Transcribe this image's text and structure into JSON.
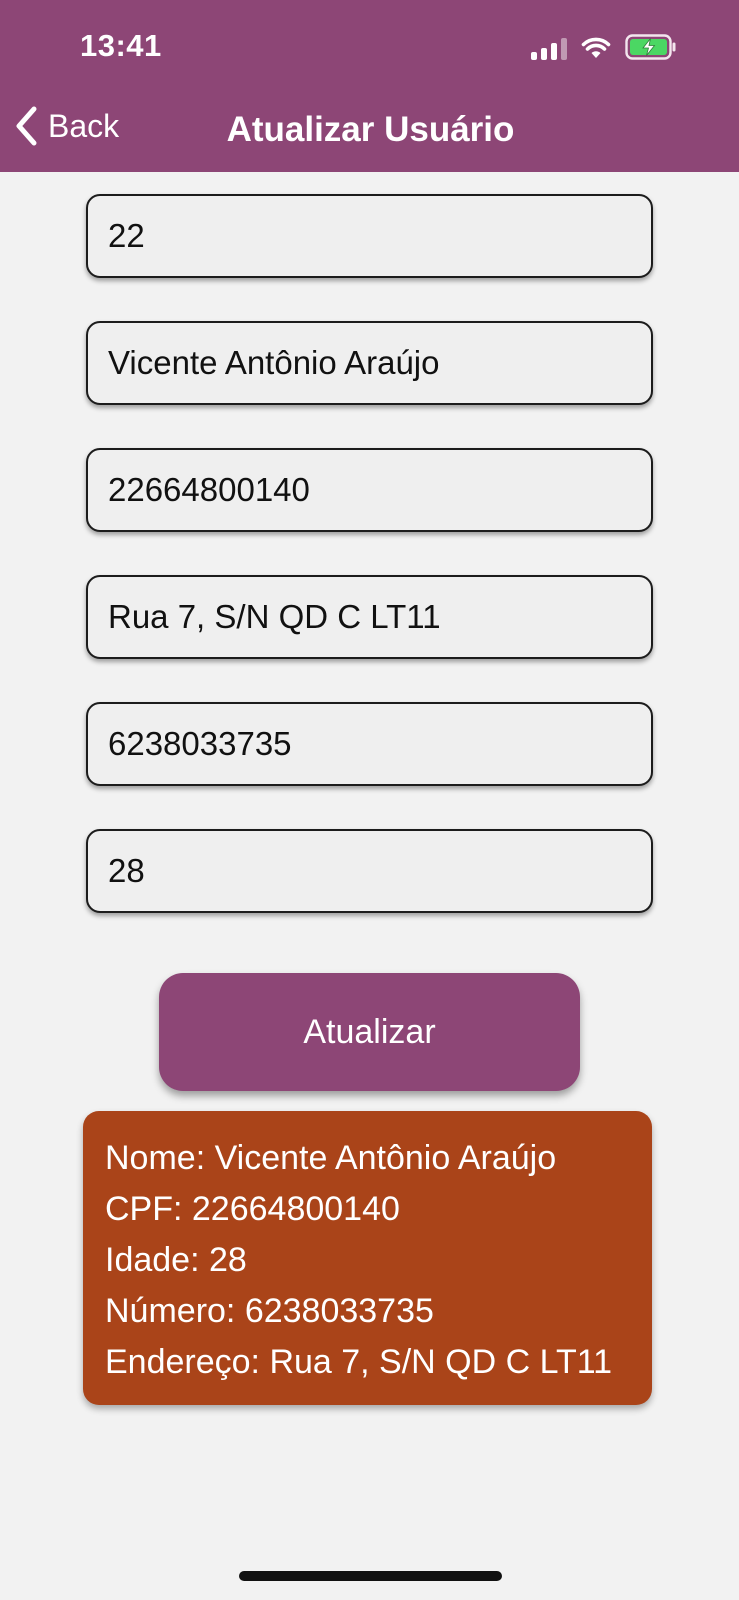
{
  "status_bar": {
    "time": "13:41"
  },
  "nav": {
    "back_label": "Back",
    "title": "Atualizar Usuário"
  },
  "form": {
    "fields": [
      {
        "value": "22"
      },
      {
        "value": "Vicente Antônio Araújo"
      },
      {
        "value": "22664800140"
      },
      {
        "value": "Rua 7, S/N QD C LT11"
      },
      {
        "value": "6238033735"
      },
      {
        "value": "28"
      }
    ],
    "submit_label": "Atualizar"
  },
  "result": {
    "lines": [
      "Nome: Vicente Antônio Araújo",
      "CPF: 22664800140",
      "Idade: 28",
      "Número: 6238033735",
      "Endereço: Rua 7, S/N QD C LT11"
    ]
  },
  "colors": {
    "header": "#8d4676",
    "button": "#8d4676",
    "result_card": "#aa4419",
    "background": "#f2f2f2"
  },
  "icons": {
    "back": "chevron-left-icon",
    "signal": "cellular-signal-icon",
    "wifi": "wifi-icon",
    "battery": "battery-charging-icon"
  }
}
